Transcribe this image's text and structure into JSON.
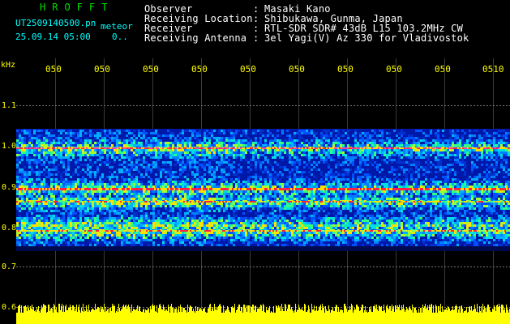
{
  "app": {
    "name": "HROFFT"
  },
  "file": {
    "filename": "UT2509140500.pn",
    "mode": "meteor",
    "datetime": "25.09.14 05:00",
    "counter": "0.."
  },
  "info": [
    {
      "label": "Observer",
      "value": "Masaki Kano"
    },
    {
      "label": "Receiving Location",
      "value": "Shibukawa, Gunma, Japan"
    },
    {
      "label": "Receiver",
      "value": "RTL-SDR SDR# 43dB L15 103.2MHz CW"
    },
    {
      "label": "Receiving Antenna",
      "value": "3el Yagi(V) Az 330 for Vladivostok"
    }
  ],
  "axis": {
    "y_unit": "kHz",
    "y_ticks": [
      "1.1",
      "1.0",
      "0.9",
      "0.8",
      "0.7",
      "0.6"
    ],
    "x_ticks": [
      "050",
      "050",
      "050",
      "050",
      "050",
      "050",
      "050",
      "050",
      "050",
      "0510"
    ]
  },
  "colors": {
    "tick": "#ffff00",
    "cyan": "#00ffff",
    "logo": "#00e000",
    "bg": "#000000"
  }
}
